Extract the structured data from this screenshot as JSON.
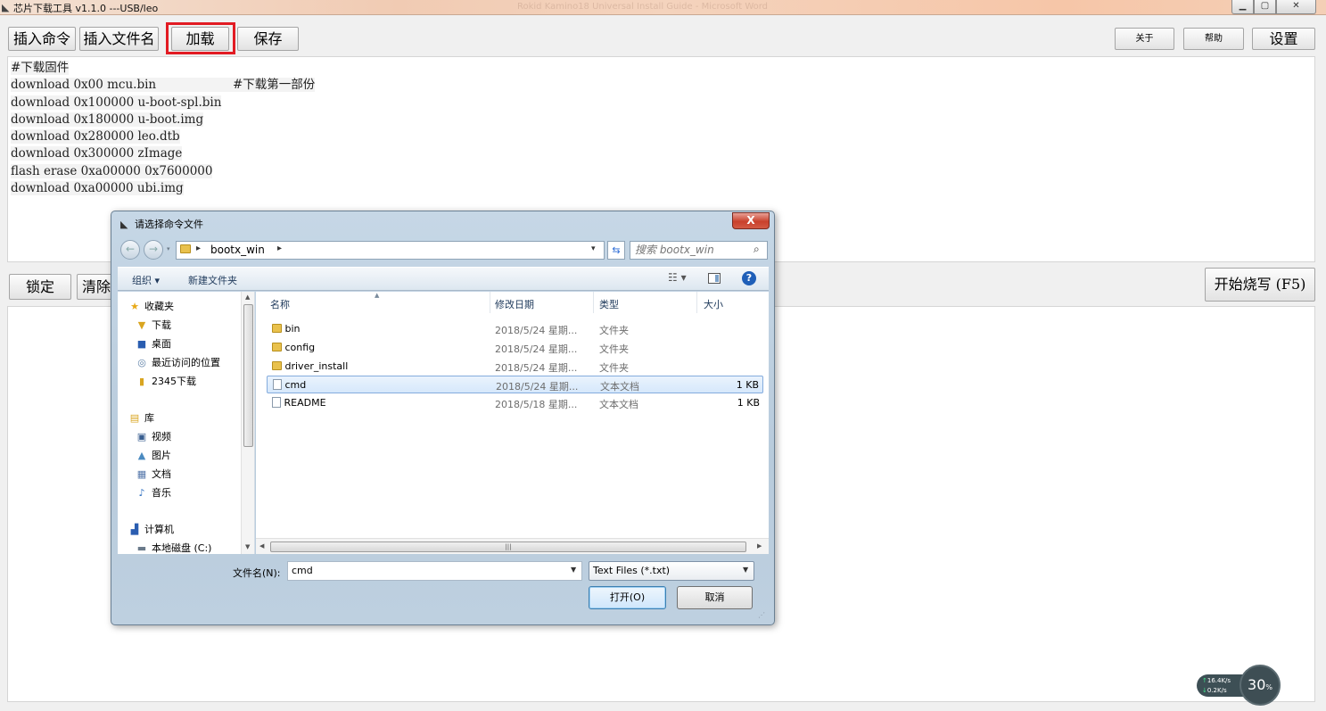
{
  "window": {
    "title": "芯片下载工具 v1.1.0 ---USB/leo",
    "background_doc_title": "Rokid Kamino18 Universal Install Guide - Microsoft Word",
    "min_icon": "minimize-icon",
    "max_icon": "maximize-icon",
    "close_icon": "close-icon",
    "min_label": "▁",
    "max_label": "▢",
    "close_label": "✕"
  },
  "toolbar": {
    "insert_command": "插入命令",
    "insert_filename": "插入文件名",
    "load": "加载",
    "save": "保存",
    "about": "关于",
    "help": "帮助",
    "settings": "设置",
    "highlight_color": "#e21b23"
  },
  "editor": {
    "lines": [
      "#下载固件",
      "download 0x00 mcu.bin                    #下载第一部份",
      "download 0x100000 u-boot-spl.bin",
      "download 0x180000 u-boot.img",
      "download 0x280000 leo.dtb",
      "download 0x300000 zImage",
      "flash erase 0xa00000 0x7600000",
      "download 0xa00000 ubi.img"
    ]
  },
  "actions": {
    "lock": "锁定",
    "clear": "清除",
    "start_burn": "开始烧写 (F5)"
  },
  "net_widget": {
    "up": "16.4K/s",
    "down": "0.2K/s",
    "percent": "30",
    "percent_unit": "%"
  },
  "dialog": {
    "title": "请选择命令文件",
    "close_label": "X",
    "address": {
      "path": "bootx_win"
    },
    "search_placeholder": "搜索 bootx_win",
    "toolbar": {
      "organize": "组织 ▾",
      "new_folder": "新建文件夹"
    },
    "nav": {
      "items": [
        {
          "label": "收藏夹",
          "icon": "star-icon"
        },
        {
          "label": "下载",
          "icon": "download-folder-icon"
        },
        {
          "label": "桌面",
          "icon": "desktop-icon"
        },
        {
          "label": "最近访问的位置",
          "icon": "recent-places-icon"
        },
        {
          "label": "2345下载",
          "icon": "folder-icon"
        },
        {
          "label": "库",
          "icon": "library-icon"
        },
        {
          "label": "视频",
          "icon": "video-icon"
        },
        {
          "label": "图片",
          "icon": "pictures-icon"
        },
        {
          "label": "文档",
          "icon": "documents-icon"
        },
        {
          "label": "音乐",
          "icon": "music-icon"
        },
        {
          "label": "计算机",
          "icon": "computer-icon"
        },
        {
          "label": "本地磁盘 (C:)",
          "icon": "drive-icon"
        }
      ]
    },
    "columns": {
      "name": "名称",
      "modified": "修改日期",
      "type": "类型",
      "size": "大小"
    },
    "files": [
      {
        "name": "bin",
        "modified": "2018/5/24 星期...",
        "type": "文件夹",
        "size": "",
        "icon": "folder-icon",
        "selected": false
      },
      {
        "name": "config",
        "modified": "2018/5/24 星期...",
        "type": "文件夹",
        "size": "",
        "icon": "folder-icon",
        "selected": false
      },
      {
        "name": "driver_install",
        "modified": "2018/5/24 星期...",
        "type": "文件夹",
        "size": "",
        "icon": "folder-icon",
        "selected": false
      },
      {
        "name": "cmd",
        "modified": "2018/5/24 星期...",
        "type": "文本文档",
        "size": "1 KB",
        "icon": "text-file-icon",
        "selected": true
      },
      {
        "name": "README",
        "modified": "2018/5/18 星期...",
        "type": "文本文档",
        "size": "1 KB",
        "icon": "text-file-icon",
        "selected": false
      }
    ],
    "filename_label": "文件名(N):",
    "filename_value": "cmd",
    "filter_value": "Text Files (*.txt)",
    "open": "打开(O)",
    "cancel": "取消"
  }
}
